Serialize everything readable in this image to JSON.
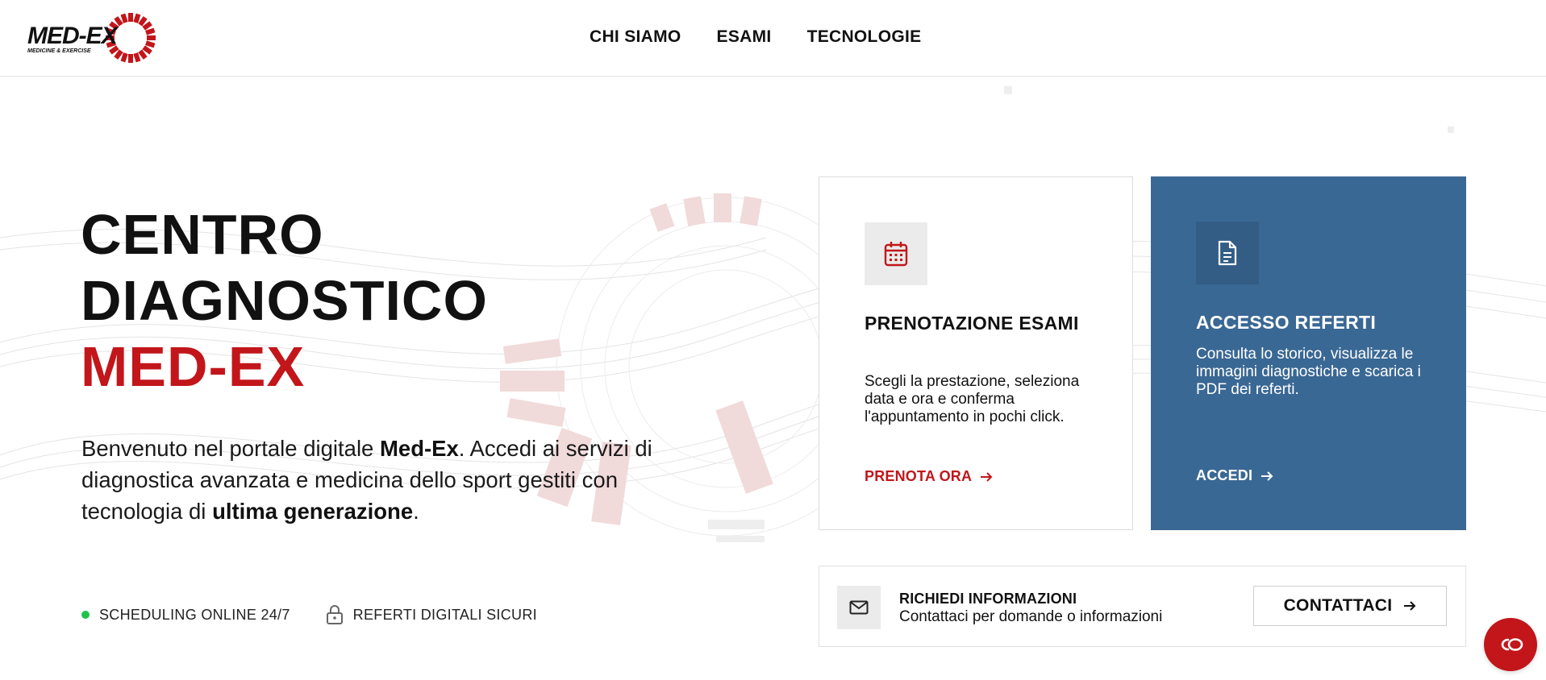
{
  "header": {
    "logo_text": "MED-EX",
    "logo_tagline": "MEDICINE & EXERCISE",
    "nav": [
      "CHI SIAMO",
      "ESAMI",
      "TECNOLOGIE"
    ]
  },
  "hero": {
    "title_line1": "CENTRO",
    "title_line2": "DIAGNOSTICO",
    "title_line3": "MED-EX",
    "desc_part1": "Benvenuto nel portale digitale ",
    "desc_bold1": "Med-Ex",
    "desc_part2": ". Accedi ai servizi di diagnostica avanzata e medicina dello sport gestiti con tecnologia di ",
    "desc_bold2": "ultima generazione",
    "desc_part3": ".",
    "features": [
      {
        "label": "SCHEDULING ONLINE 24/7",
        "icon": "status-dot"
      },
      {
        "label": "REFERTI DIGITALI SICURI",
        "icon": "lock-icon"
      }
    ]
  },
  "cards": {
    "booking": {
      "title": "PRENOTAZIONE ESAMI",
      "text": "Scegli la prestazione, seleziona data e ora e conferma l'appuntamento in pochi click.",
      "cta": "PRENOTA ORA",
      "icon": "calendar-icon"
    },
    "reports": {
      "title": "ACCESSO REFERTI",
      "text": "Consulta lo storico, visualizza le immagini diagnostiche e scarica i PDF dei referti.",
      "cta": "ACCEDI",
      "icon": "document-icon"
    }
  },
  "contact": {
    "title": "RICHIEDI INFORMAZIONI",
    "subtitle": "Contattaci per domande o informazioni",
    "button": "CONTATTACI",
    "icon": "mail-icon"
  },
  "chat": {
    "icon": "chat-icon"
  },
  "colors": {
    "brand_red": "#c2161b",
    "card_blue": "#3a6894",
    "status_green": "#1fc24a"
  }
}
